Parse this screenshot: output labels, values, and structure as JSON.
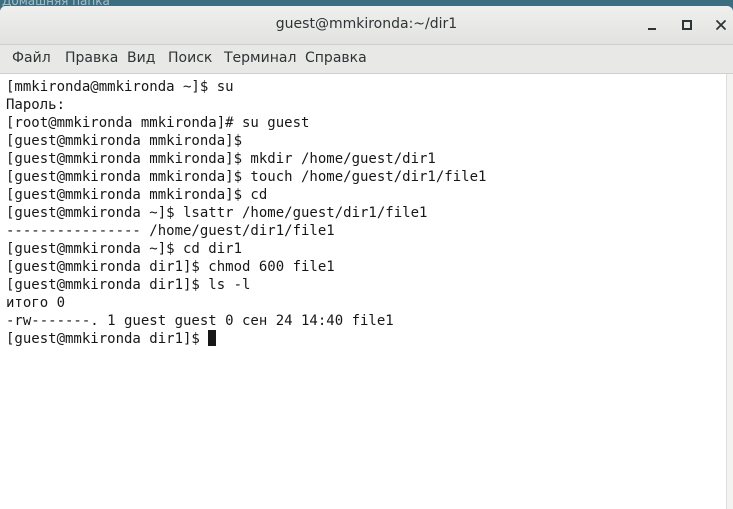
{
  "desktop": {
    "folder_label": "Домашняя папка"
  },
  "window": {
    "title": "guest@mmkironda:~/dir1",
    "controls": {
      "minimize_icon": "minimize-icon",
      "maximize_icon": "maximize-icon",
      "close_icon": "close-icon"
    }
  },
  "menubar": {
    "items": [
      "Файл",
      "Правка",
      "Вид",
      "Поиск",
      "Терминал",
      "Справка"
    ]
  },
  "terminal": {
    "lines": [
      "[mmkironda@mmkironda ~]$ su",
      "Пароль:",
      "[root@mmkironda mmkironda]# su guest",
      "[guest@mmkironda mmkironda]$",
      "[guest@mmkironda mmkironda]$ mkdir /home/guest/dir1",
      "[guest@mmkironda mmkironda]$ touch /home/guest/dir1/file1",
      "[guest@mmkironda mmkironda]$ cd",
      "[guest@mmkironda ~]$ lsattr /home/guest/dir1/file1",
      "---------------- /home/guest/dir1/file1",
      "[guest@mmkironda ~]$ cd dir1",
      "[guest@mmkironda dir1]$ chmod 600 file1",
      "[guest@mmkironda dir1]$ ls -l",
      "итого 0",
      "-rw-------. 1 guest guest 0 сен 24 14:40 file1"
    ],
    "prompt": "[guest@mmkironda dir1]$ "
  }
}
